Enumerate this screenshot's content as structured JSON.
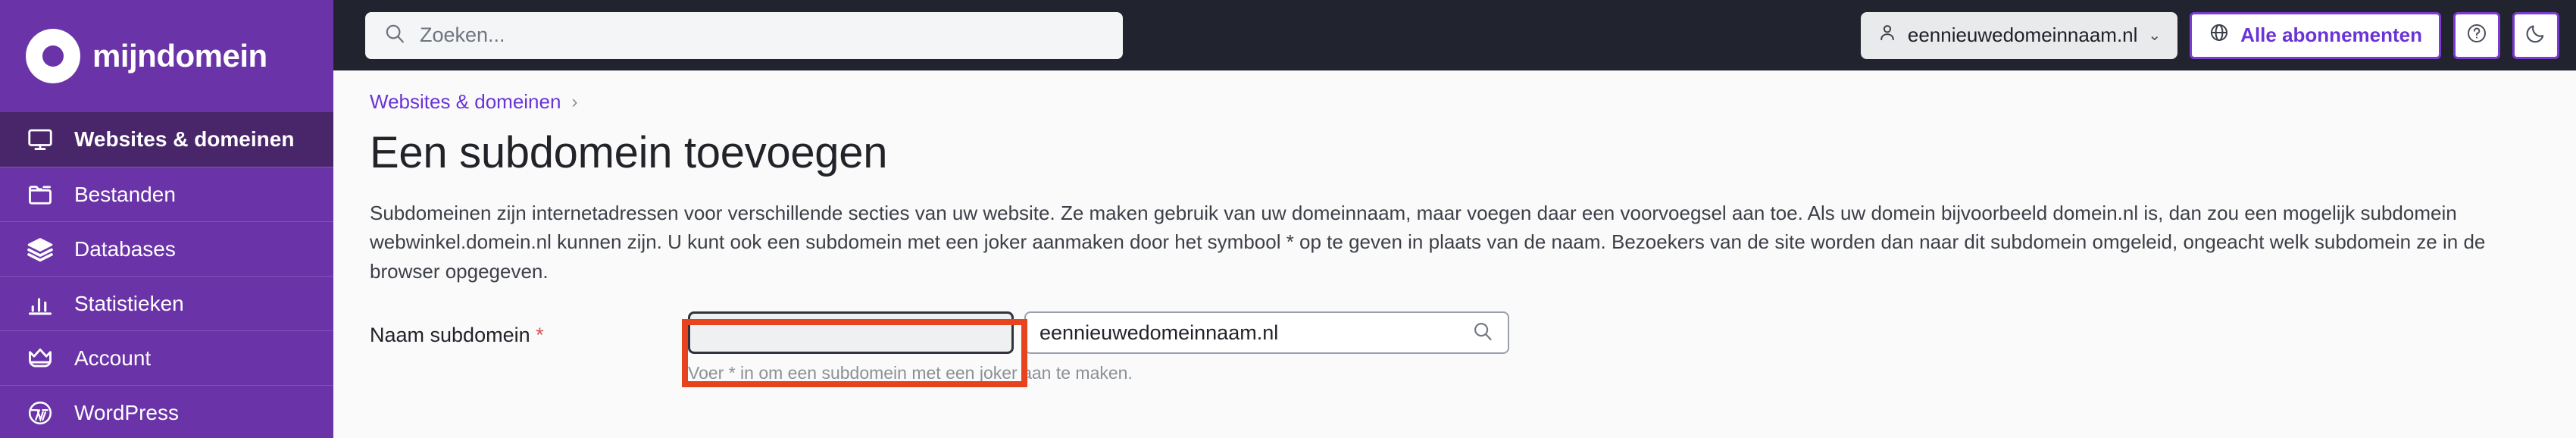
{
  "brand": {
    "name": "mijndomein",
    "logo_icon": "ring-logo-icon"
  },
  "sidebar": {
    "items": [
      {
        "label": "Websites & domeinen",
        "icon": "monitor-icon",
        "active": true
      },
      {
        "label": "Bestanden",
        "icon": "folder-icon",
        "active": false
      },
      {
        "label": "Databases",
        "icon": "database-stack-icon",
        "active": false
      },
      {
        "label": "Statistieken",
        "icon": "bar-chart-icon",
        "active": false
      },
      {
        "label": "Account",
        "icon": "crown-icon",
        "active": false
      },
      {
        "label": "WordPress",
        "icon": "wordpress-icon",
        "active": false
      }
    ]
  },
  "topbar": {
    "search": {
      "placeholder": "Zoeken...",
      "value": "",
      "icon": "search-icon"
    },
    "account_chip": {
      "label": "eennieuwedomeinnaam.nl",
      "icon": "user-icon",
      "caret": "⌄"
    },
    "subscriptions_button": {
      "label": "Alle abonnementen",
      "icon": "globe-icon"
    },
    "help_button": {
      "icon": "question-circle-icon"
    },
    "theme_button": {
      "icon": "moon-icon"
    }
  },
  "breadcrumb": {
    "item": "Websites & domeinen",
    "separator": "›"
  },
  "page": {
    "title": "Een subdomein toevoegen",
    "intro": "Subdomeinen zijn internetadressen voor verschillende secties van uw website. Ze maken gebruik van uw domeinnaam, maar voegen daar een voorvoegsel aan toe. Als uw domein bijvoorbeeld domein.nl is, dan zou een mogelijk subdomein webwinkel.domein.nl kunnen zijn. U kunt ook een subdomein met een joker aanmaken door het symbool * op te geven in plaats van de naam. Bezoekers van de site worden dan naar dit subdomein omgeleid, ongeacht welk subdomein ze in de browser opgegeven."
  },
  "form": {
    "label": "Naam subdomein",
    "required_marker": "*",
    "subdomain_input": {
      "value": "",
      "placeholder": ""
    },
    "domain_select": {
      "value": "eennieuwedomeinnaam.nl",
      "icon": "search-icon"
    },
    "hint": "Voer * in om een subdomein met een joker aan te maken."
  },
  "annotation": {
    "color": "#e8431f",
    "target": "subdomain-name-input"
  },
  "colors": {
    "sidebar_purple": "#6a33a8",
    "sidebar_active": "#482669",
    "topbar_dark": "#21242e",
    "accent_purple": "#6a33d8",
    "required_red": "#d9534f",
    "annotation_red": "#e8431f"
  }
}
